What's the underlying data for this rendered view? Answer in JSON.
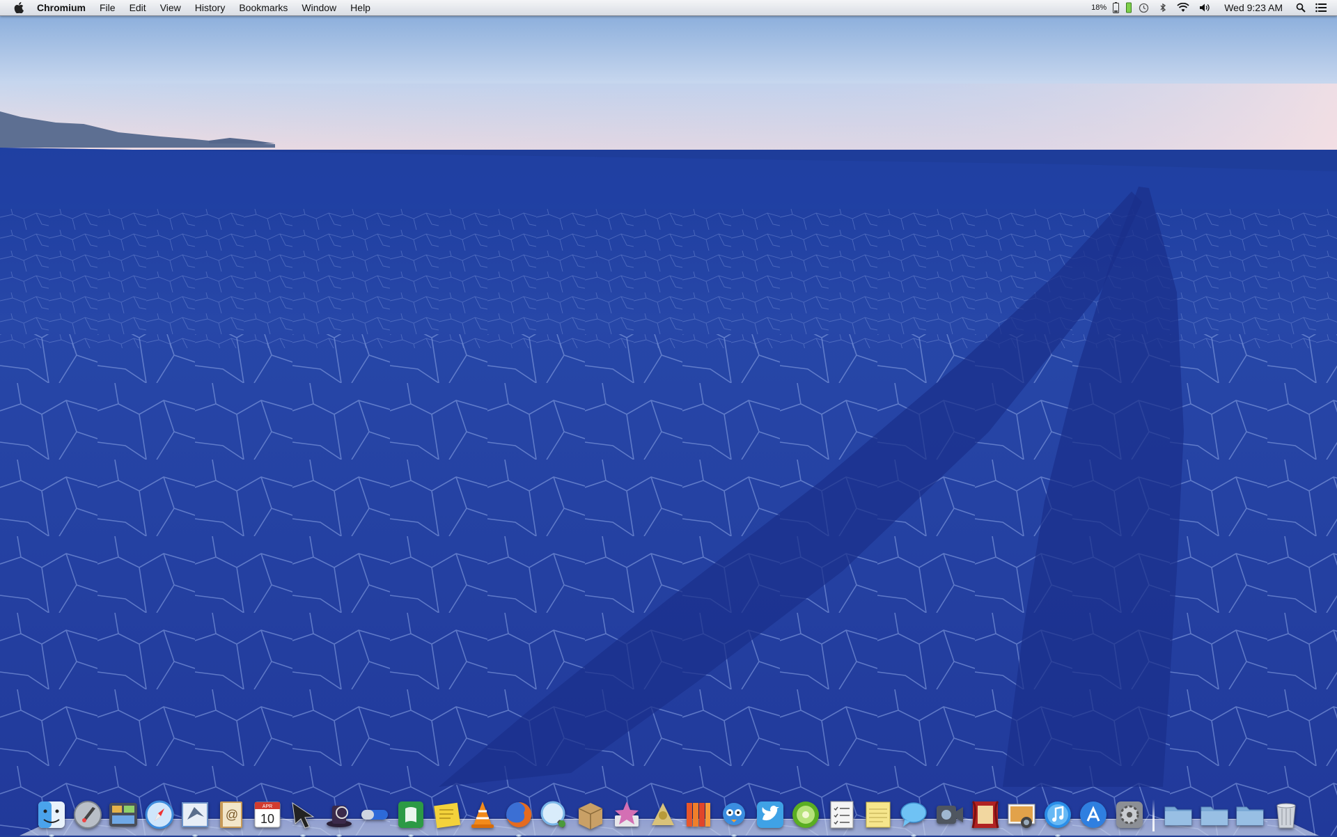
{
  "menubar": {
    "app_name": "Chromium",
    "menus": [
      "File",
      "Edit",
      "View",
      "History",
      "Bookmarks",
      "Window",
      "Help"
    ],
    "battery_percent": "18%",
    "clock": "Wed 9:23 AM",
    "status_icons": [
      "battery-icon",
      "battery-green-icon",
      "time-machine-icon",
      "bluetooth-icon",
      "wifi-icon",
      "volume-icon",
      "spotlight-icon",
      "notification-center-icon"
    ]
  },
  "dock": {
    "apps": [
      {
        "name": "finder-icon",
        "color": "#4aa3ec"
      },
      {
        "name": "launchpad-icon",
        "color": "#9aa3ad"
      },
      {
        "name": "mission-control-icon",
        "color": "#4a4f5a"
      },
      {
        "name": "safari-icon",
        "color": "#3c8bdc"
      },
      {
        "name": "mail-icon",
        "color": "#6e93c9"
      },
      {
        "name": "contacts-icon",
        "color": "#c79a58"
      },
      {
        "name": "calendar-icon",
        "color": "#ffffff",
        "day": "10",
        "month": "APR"
      },
      {
        "name": "cursor-pro-icon",
        "color": "#222222"
      },
      {
        "name": "alfred-icon",
        "color": "#3b2a4a"
      },
      {
        "name": "toggle-app-icon",
        "color": "#2d6ad9"
      },
      {
        "name": "evernote-icon",
        "color": "#2c9a45"
      },
      {
        "name": "stickies-icon",
        "color": "#f3d23b"
      },
      {
        "name": "vlc-icon",
        "color": "#f28a1a"
      },
      {
        "name": "firefox-icon",
        "color": "#e56b1f"
      },
      {
        "name": "quicktime-icon",
        "color": "#7ab6e8"
      },
      {
        "name": "archive-utility-icon",
        "color": "#c9a066"
      },
      {
        "name": "itunes-star-icon",
        "color": "#d46fb4"
      },
      {
        "name": "reeder-icon",
        "color": "#b89a3a"
      },
      {
        "name": "ibooks-icon",
        "color": "#e8562a"
      },
      {
        "name": "tweetbot-icon",
        "color": "#3b8ee0"
      },
      {
        "name": "twitter-icon",
        "color": "#3fa2e6"
      },
      {
        "name": "kiwi-icon",
        "color": "#5aae22"
      },
      {
        "name": "reminders-icon",
        "color": "#f4f4f4"
      },
      {
        "name": "notes-icon",
        "color": "#f6e68c"
      },
      {
        "name": "messages-icon",
        "color": "#6fc2f4"
      },
      {
        "name": "facetime-icon",
        "color": "#4f5660"
      },
      {
        "name": "photo-booth-icon",
        "color": "#b02222"
      },
      {
        "name": "iphoto-icon",
        "color": "#7c6a50"
      },
      {
        "name": "itunes-icon",
        "color": "#2a8ee8"
      },
      {
        "name": "app-store-icon",
        "color": "#2f7fe0"
      },
      {
        "name": "system-preferences-icon",
        "color": "#8c8f95"
      }
    ],
    "folders": [
      {
        "name": "applications-folder-icon",
        "color": "#7aa9d6"
      },
      {
        "name": "documents-folder-icon",
        "color": "#7aa9d6"
      },
      {
        "name": "downloads-folder-icon",
        "color": "#7aa9d6"
      },
      {
        "name": "trash-icon",
        "color": "#b9bec6"
      }
    ]
  }
}
